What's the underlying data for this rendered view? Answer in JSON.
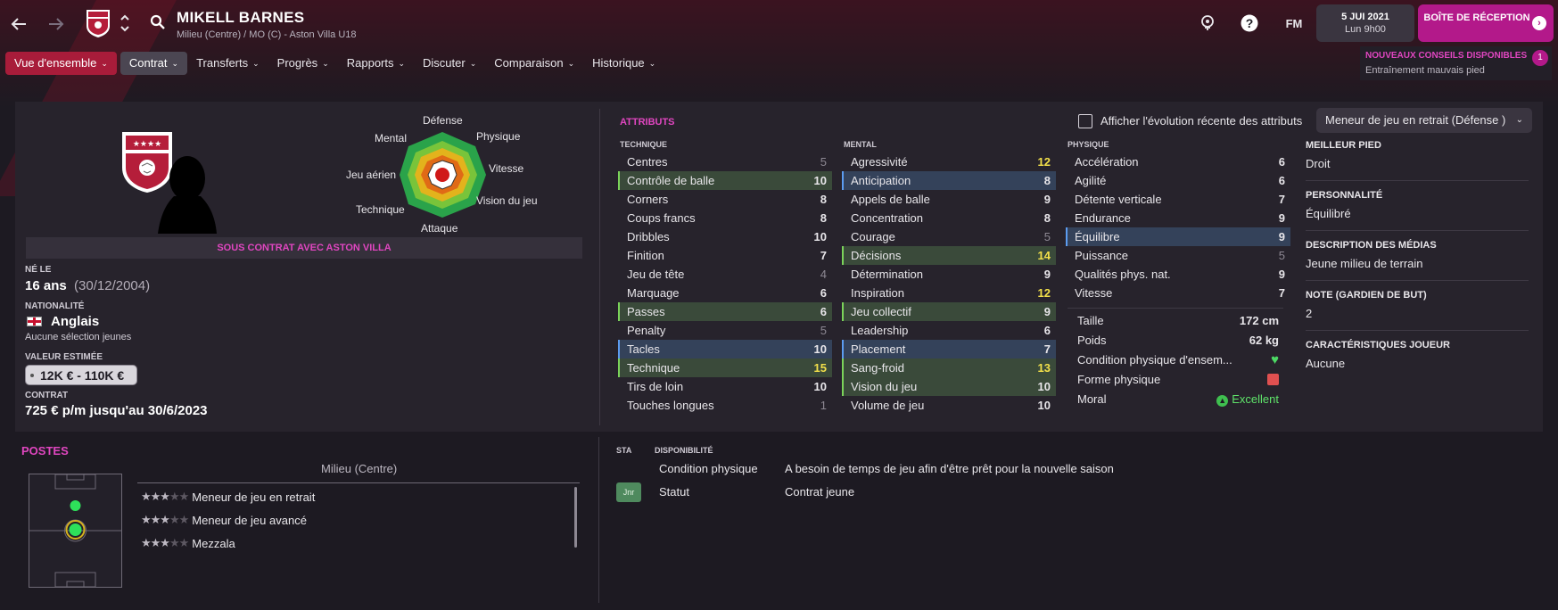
{
  "header": {
    "player_name": "MIKELL BARNES",
    "player_sub": "Milieu (Centre) / MO (C) - Aston Villa U18",
    "fm_label": "FM",
    "date": "5 JUI 2021",
    "time": "Lun 9h00",
    "inbox_label": "BOÎTE DE RÉCEPTION"
  },
  "nav": {
    "items": [
      {
        "label": "Vue d'ensemble"
      },
      {
        "label": "Contrat"
      },
      {
        "label": "Transferts"
      },
      {
        "label": "Progrès"
      },
      {
        "label": "Rapports"
      },
      {
        "label": "Discuter"
      },
      {
        "label": "Comparaison"
      },
      {
        "label": "Historique"
      }
    ]
  },
  "advice": {
    "title": "NOUVEAUX CONSEILS DISPONIBLES",
    "text": "Entraînement mauvais pied",
    "count": "1"
  },
  "radar": {
    "labels": {
      "defense": "Défense",
      "physique": "Physique",
      "vitesse": "Vitesse",
      "vision": "Vision du jeu",
      "attaque": "Attaque",
      "technique": "Technique",
      "jeu_aerien": "Jeu aérien",
      "mental": "Mental"
    }
  },
  "profile": {
    "contract_banner": "SOUS CONTRAT AVEC ASTON VILLA",
    "born_label": "NÉ LE",
    "age": "16 ans",
    "birthdate": "(30/12/2004)",
    "nationality_label": "NATIONALITÉ",
    "nationality": "Anglais",
    "caps": "Aucune sélection jeunes",
    "value_label": "VALEUR ESTIMÉE",
    "value": "12K € - 110K €",
    "contract_label": "CONTRAT",
    "contract": "725 € p/m jusqu'au 30/6/2023"
  },
  "attributes": {
    "title": "ATTRIBUTS",
    "toggle_label": "Afficher l'évolution récente des attributs",
    "role_select": "Meneur de jeu en retrait (Défense )",
    "technique_header": "TECHNIQUE",
    "mental_header": "MENTAL",
    "physique_header": "PHYSIQUE",
    "technique": [
      {
        "name": "Centres",
        "value": "5"
      },
      {
        "name": "Contrôle de balle",
        "value": "10"
      },
      {
        "name": "Corners",
        "value": "8"
      },
      {
        "name": "Coups francs",
        "value": "8"
      },
      {
        "name": "Dribbles",
        "value": "10"
      },
      {
        "name": "Finition",
        "value": "7"
      },
      {
        "name": "Jeu de tête",
        "value": "4"
      },
      {
        "name": "Marquage",
        "value": "6"
      },
      {
        "name": "Passes",
        "value": "6"
      },
      {
        "name": "Penalty",
        "value": "5"
      },
      {
        "name": "Tacles",
        "value": "10"
      },
      {
        "name": "Technique",
        "value": "15"
      },
      {
        "name": "Tirs de loin",
        "value": "10"
      },
      {
        "name": "Touches longues",
        "value": "1"
      }
    ],
    "mental": [
      {
        "name": "Agressivité",
        "value": "12"
      },
      {
        "name": "Anticipation",
        "value": "8"
      },
      {
        "name": "Appels de balle",
        "value": "9"
      },
      {
        "name": "Concentration",
        "value": "8"
      },
      {
        "name": "Courage",
        "value": "5"
      },
      {
        "name": "Décisions",
        "value": "14"
      },
      {
        "name": "Détermination",
        "value": "9"
      },
      {
        "name": "Inspiration",
        "value": "12"
      },
      {
        "name": "Jeu collectif",
        "value": "9"
      },
      {
        "name": "Leadership",
        "value": "6"
      },
      {
        "name": "Placement",
        "value": "7"
      },
      {
        "name": "Sang-froid",
        "value": "13"
      },
      {
        "name": "Vision du jeu",
        "value": "10"
      },
      {
        "name": "Volume de jeu",
        "value": "10"
      }
    ],
    "physique": [
      {
        "name": "Accélération",
        "value": "6"
      },
      {
        "name": "Agilité",
        "value": "6"
      },
      {
        "name": "Détente verticale",
        "value": "7"
      },
      {
        "name": "Endurance",
        "value": "9"
      },
      {
        "name": "Équilibre",
        "value": "9"
      },
      {
        "name": "Puissance",
        "value": "5"
      },
      {
        "name": "Qualités phys. nat.",
        "value": "9"
      },
      {
        "name": "Vitesse",
        "value": "7"
      }
    ],
    "physical_info": {
      "height_label": "Taille",
      "height": "172 cm",
      "weight_label": "Poids",
      "weight": "62 kg",
      "condition_label": "Condition physique d'ensem...",
      "form_label": "Forme physique",
      "morale_label": "Moral",
      "morale": "Excellent"
    }
  },
  "side": {
    "foot_label": "MEILLEUR PIED",
    "foot": "Droit",
    "personality_label": "PERSONNALITÉ",
    "personality": "Équilibré",
    "media_label": "DESCRIPTION DES MÉDIAS",
    "media": "Jeune milieu de terrain",
    "gk_label": "NOTE (GARDIEN DE BUT)",
    "gk": "2",
    "traits_label": "CARACTÉRISTIQUES JOUEUR",
    "traits": "Aucune"
  },
  "positions": {
    "title": "POSTES",
    "header": "Milieu (Centre)",
    "roles": [
      {
        "name": "Meneur de jeu en retrait",
        "stars": 3
      },
      {
        "name": "Meneur de jeu avancé",
        "stars": 3
      },
      {
        "name": "Mezzala",
        "stars": 3
      }
    ]
  },
  "availability": {
    "sta_header": "STA",
    "dispo_header": "DISPONIBILITÉ",
    "rows": [
      {
        "label": "Condition physique",
        "value": "A besoin de temps de jeu afin d'être prêt pour la nouvelle saison"
      },
      {
        "label": "Statut",
        "value": "Contrat jeune",
        "badge": "Jnr"
      }
    ]
  },
  "colors": {
    "accent_pink": "#e046c0",
    "nav_active": "#a81c3a",
    "inbox": "#b3198a",
    "highlight_yellow": "#f3e04a",
    "green_good": "#4cd964"
  }
}
